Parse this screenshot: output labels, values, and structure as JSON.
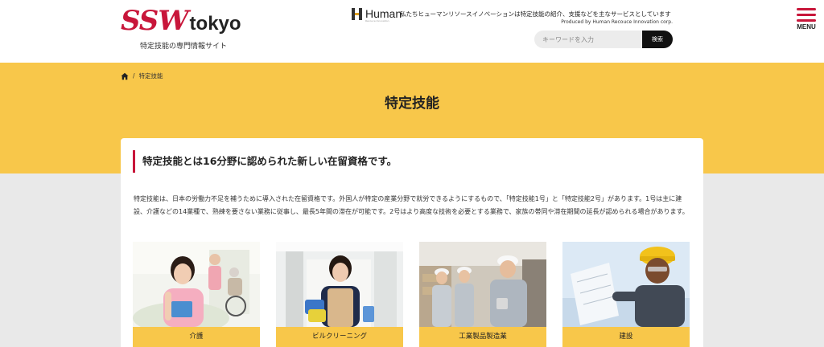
{
  "header": {
    "logo_ssw": "SSW",
    "logo_tokyo": "tokyo",
    "logo_tagline": "特定技能の専門情報サイト",
    "company_logo_text": "Human",
    "company_logo_sub": "Recouce Innovation",
    "description": "私たちヒューマンリソースイノベーションは特定技能の紹介、支援などを主なサービスとしています",
    "produced_by": "Produced by Human Recouce Innovation corp.",
    "search": {
      "placeholder": "キーワードを入力",
      "button_label": "検索"
    },
    "menu_label": "MENU"
  },
  "colors": {
    "accent": "#c8163a",
    "hero_bg": "#f8c74a",
    "page_bg": "#e9e9e9"
  },
  "breadcrumb": {
    "home_icon": "home-icon",
    "separator": "/",
    "current": "特定技能"
  },
  "page_title": "特定技能",
  "section": {
    "heading": "特定技能とは16分野に認められた新しい在留資格です。",
    "body": "特定技能は、日本の労働力不足を補うために導入された在留資格です。外国人が特定の産業分野で就労できるようにするもので、「特定技能1号」と「特定技能2号」があります。1号は主に建設、介護などの14業種で、熟練を要さない業務に従事し、最長5年間の滞在が可能です。2号はより高度な技術を必要とする業務で、家族の帯同や滞在期間の延長が認められる場合があります。"
  },
  "fields": [
    {
      "label": "介護"
    },
    {
      "label": "ビルクリーニング"
    },
    {
      "label": "工業製品製造業"
    },
    {
      "label": "建設"
    }
  ]
}
